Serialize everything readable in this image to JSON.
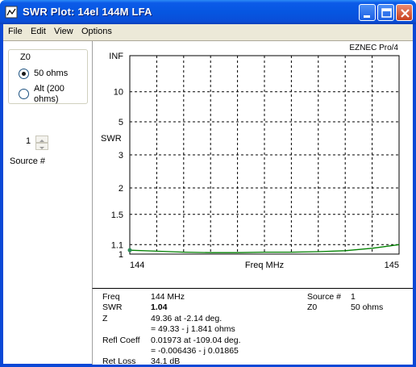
{
  "window": {
    "title": "SWR Plot: 14el 144M LFA",
    "controls": [
      "minimize",
      "maximize",
      "close"
    ]
  },
  "menu": [
    "File",
    "Edit",
    "View",
    "Options"
  ],
  "z0_group": {
    "legend": "Z0",
    "options": [
      {
        "label": "50 ohms",
        "selected": true
      },
      {
        "label": "Alt (200 ohms)",
        "selected": false
      }
    ]
  },
  "source": {
    "value": "1",
    "label": "Source #"
  },
  "plot": {
    "brand": "EZNEC Pro/4",
    "ylabel": "SWR",
    "xlabel": "Freq MHz",
    "x_start_label": "144",
    "x_end_label": "145",
    "y_ticks": [
      "INF",
      "10",
      "5",
      "3",
      "2",
      "1.5",
      "1.1",
      "1"
    ],
    "line_color": "#008000",
    "marker_color": "#2e8b57"
  },
  "chart_data": {
    "type": "line",
    "title": "",
    "xlabel": "Freq MHz",
    "ylabel": "SWR",
    "xlim": [
      144,
      145
    ],
    "ylim": [
      1,
      "INF"
    ],
    "y_scale": "reflection-coefficient (SWR) scale",
    "grid": true,
    "series": [
      {
        "x": [
          144.0,
          144.1,
          144.2,
          144.3,
          144.4,
          144.5,
          144.6,
          144.7,
          144.8,
          144.9,
          145.0
        ],
        "values": [
          1.04,
          1.03,
          1.02,
          1.015,
          1.015,
          1.02,
          1.02,
          1.025,
          1.035,
          1.06,
          1.1
        ]
      }
    ],
    "marker": {
      "x": 144.0,
      "y": 1.04
    }
  },
  "readout": {
    "freq_label": "Freq",
    "freq_value": "144 MHz",
    "swr_label": "SWR",
    "swr_value": "1.04",
    "z_label": "Z",
    "z_value1": "49.36 at -2.14 deg.",
    "z_value2": "= 49.33 - j 1.841 ohms",
    "refl_label": "Refl Coeff",
    "refl_value1": "0.01973 at -109.04 deg.",
    "refl_value2": "= -0.006436 - j 0.01865",
    "retloss_label": "Ret Loss",
    "retloss_value": "34.1 dB",
    "source_label": "Source #",
    "source_value": "1",
    "z0_label": "Z0",
    "z0_value": "50 ohms"
  }
}
